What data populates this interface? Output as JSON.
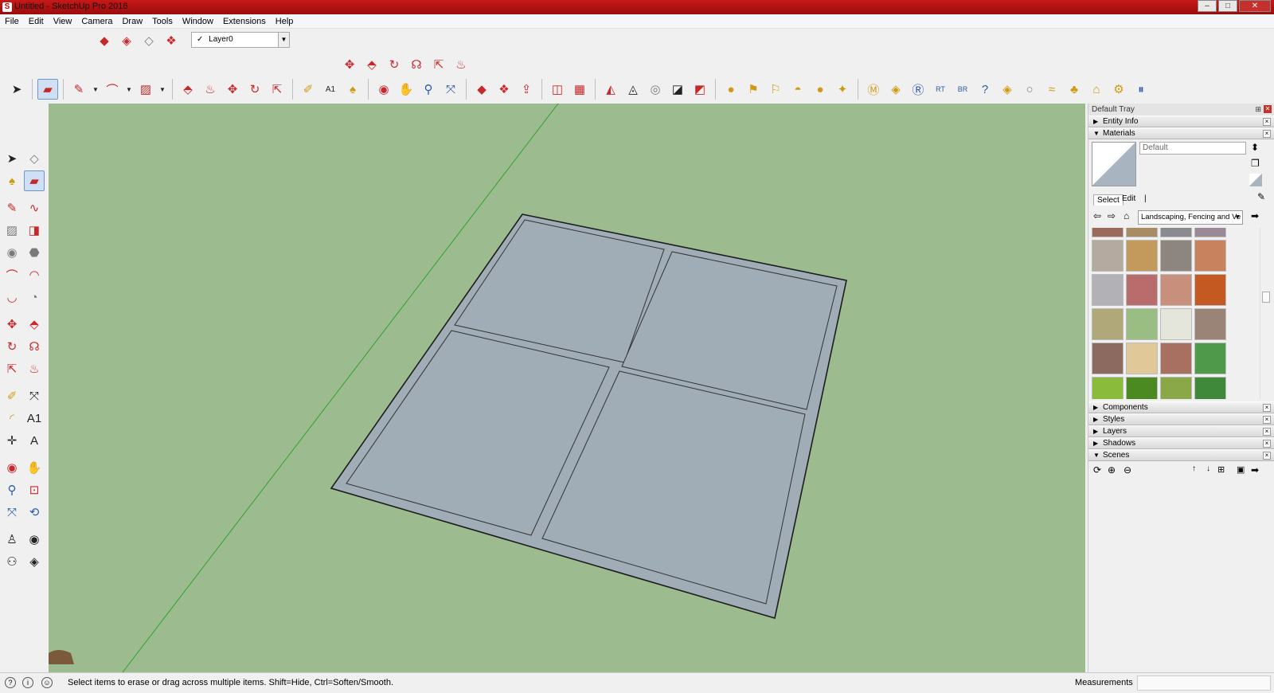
{
  "window": {
    "title": "Untitled - SketchUp Pro 2016"
  },
  "menu": [
    "File",
    "Edit",
    "View",
    "Camera",
    "Draw",
    "Tools",
    "Window",
    "Extensions",
    "Help"
  ],
  "layer": {
    "current": "Layer0",
    "check": "✓"
  },
  "tray": {
    "title": "Default Tray",
    "entity_info": "Entity Info",
    "materials": "Materials",
    "material_name_placeholder": "Default",
    "tab_select": "Select",
    "tab_edit": "Edit",
    "library": "Landscaping, Fencing and Ve",
    "panels": [
      "Components",
      "Styles",
      "Layers",
      "Shadows",
      "Scenes"
    ]
  },
  "status": {
    "message": "Select items to erase or drag across multiple items. Shift=Hide, Ctrl=Soften/Smooth.",
    "measurements_label": "Measurements",
    "measurements_value": ""
  },
  "colors": {
    "viewport": "#9cbc8f",
    "face": "#a0acb6",
    "title_bar": "#b81212"
  },
  "active_tool": "eraser-tool"
}
